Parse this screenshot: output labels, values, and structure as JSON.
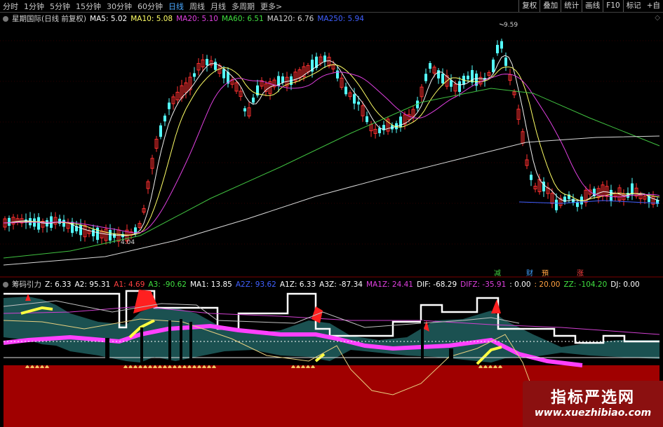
{
  "toolbar": {
    "tabs": [
      "分时",
      "1分钟",
      "5分钟",
      "15分钟",
      "30分钟",
      "60分钟",
      "日线",
      "周线",
      "月线",
      "多周期",
      "更多>"
    ],
    "active_tab": "日线",
    "right_buttons": [
      "复权",
      "叠加",
      "统计",
      "画线",
      "F10",
      "标记"
    ],
    "right_edge": "+自"
  },
  "main": {
    "title": "星期国际(日线 前复权)",
    "ma": [
      {
        "label": "MA5: 5.02",
        "color": "#ffffff"
      },
      {
        "label": "MA10: 5.08",
        "color": "#ffff66"
      },
      {
        "label": "MA20: 5.10",
        "color": "#e040e0"
      },
      {
        "label": "MA60: 6.51",
        "color": "#40e040"
      },
      {
        "label": "MA120: 6.76",
        "color": "#d0d0d0"
      },
      {
        "label": "MA250: 5.94",
        "color": "#4060ff"
      }
    ],
    "high_label": "9.59",
    "low_label": "4.04",
    "markers": [
      {
        "text": "减",
        "color": "#40d040"
      },
      {
        "text": "财",
        "color": "#40a0ff"
      },
      {
        "text": "預",
        "color": "#ffa040"
      },
      {
        "text": "涨",
        "color": "#ff4040"
      }
    ]
  },
  "indicator": {
    "title": "筹码引力",
    "params": [
      {
        "label": "Z: 6.33",
        "color": "#ffffff"
      },
      {
        "label": "A2: 95.31",
        "color": "#ffffff"
      },
      {
        "label": "A1: 4.69",
        "color": "#ff4040"
      },
      {
        "label": "A3: -90.62",
        "color": "#40e040"
      },
      {
        "label": "MA1: 13.85",
        "color": "#ffffff"
      },
      {
        "label": "A2Z: 93.62",
        "color": "#4060ff"
      },
      {
        "label": "A1Z: 6.33",
        "color": "#ffffff"
      },
      {
        "label": "A3Z: -87.34",
        "color": "#ffffff"
      },
      {
        "label": "MA1Z: 24.41",
        "color": "#e040e0"
      },
      {
        "label": "DIF: -68.29",
        "color": "#ffffff"
      },
      {
        "label": "DIFZ: -35.91",
        "color": "#e040e0"
      },
      {
        "label": ": 0.00",
        "color": "#ffffff"
      },
      {
        "label": ": 20.00",
        "color": "#ffa040"
      },
      {
        "label": "ZZ: -104.20",
        "color": "#40e040"
      },
      {
        "label": "DJ: 0.00",
        "color": "#ffffff"
      }
    ]
  },
  "watermark": {
    "title": "指标严选网",
    "url": "www.xuezhibiao.com"
  },
  "colors": {
    "up": "#ff3030",
    "down": "#54ffff",
    "teal": "#1e5a5a",
    "darkred": "#a00000",
    "magenta": "#ff40ff"
  }
}
